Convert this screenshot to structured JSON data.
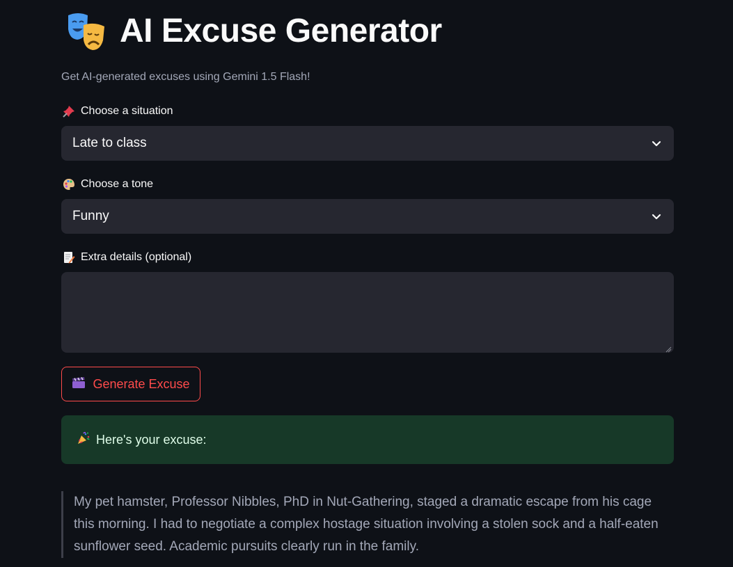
{
  "app": {
    "title": "AI Excuse Generator",
    "title_icon": "theater-masks-icon",
    "caption": "Get AI-generated excuses using Gemini 1.5 Flash!"
  },
  "form": {
    "situation": {
      "icon": "pushpin-icon",
      "label": "Choose a situation",
      "selected": "Late to class"
    },
    "tone": {
      "icon": "palette-icon",
      "label": "Choose a tone",
      "selected": "Funny"
    },
    "details": {
      "icon": "memo-icon",
      "label": "Extra details (optional)",
      "value": ""
    },
    "generate_button": {
      "icon": "clapper-board-icon",
      "label": "Generate Excuse"
    }
  },
  "result": {
    "success_icon": "party-popper-icon",
    "success_text": "Here's your excuse:",
    "excuse": "My pet hamster, Professor Nibbles, PhD in Nut-Gathering, staged a dramatic escape from his cage this morning. I had to negotiate a complex hostage situation involving a stolen sock and a half-eaten sunflower seed. Academic pursuits clearly run in the family."
  },
  "colors": {
    "background": "#0e1117",
    "input_bg": "#262730",
    "accent": "#ff4b4b",
    "success_bg": "#173928",
    "muted_text": "#a3a8b8"
  }
}
